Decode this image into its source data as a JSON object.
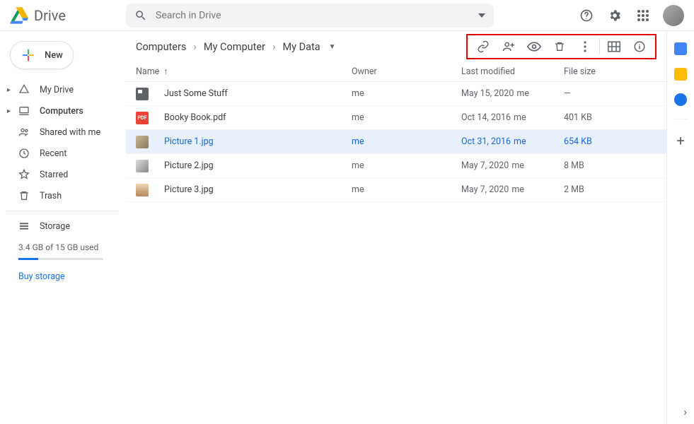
{
  "header": {
    "app_name": "Drive",
    "search_placeholder": "Search in Drive"
  },
  "sidebar": {
    "new_label": "New",
    "items": [
      {
        "icon": "mydrive",
        "label": "My Drive",
        "caret": true
      },
      {
        "icon": "computers",
        "label": "Computers",
        "caret": true,
        "selected": true
      },
      {
        "icon": "shared",
        "label": "Shared with me"
      },
      {
        "icon": "recent",
        "label": "Recent"
      },
      {
        "icon": "starred",
        "label": "Starred"
      },
      {
        "icon": "trash",
        "label": "Trash"
      }
    ],
    "storage_label": "Storage",
    "storage_used": "3.4 GB of 15 GB used",
    "buy_label": "Buy storage"
  },
  "toolbar": {
    "crumbs": [
      "Computers",
      "My Computer",
      "My Data"
    ]
  },
  "columns": {
    "name": "Name",
    "owner": "Owner",
    "modified": "Last modified",
    "size": "File size"
  },
  "rows": [
    {
      "icon": "folder",
      "name": "Just Some Stuff",
      "owner": "me",
      "modified": "May 15, 2020",
      "mod_by": "me",
      "size": "—"
    },
    {
      "icon": "pdf",
      "name": "Booky Book.pdf",
      "owner": "me",
      "modified": "Oct 14, 2016",
      "mod_by": "me",
      "size": "401 KB"
    },
    {
      "icon": "img1",
      "name": "Picture 1.jpg",
      "owner": "me",
      "modified": "Oct 31, 2016",
      "mod_by": "me",
      "size": "654 KB",
      "selected": true
    },
    {
      "icon": "img2",
      "name": "Picture 2.jpg",
      "owner": "me",
      "modified": "May 7, 2020",
      "mod_by": "me",
      "size": "8 MB"
    },
    {
      "icon": "img3",
      "name": "Picture 3.jpg",
      "owner": "me",
      "modified": "May 7, 2020",
      "mod_by": "me",
      "size": "2 MB"
    }
  ]
}
